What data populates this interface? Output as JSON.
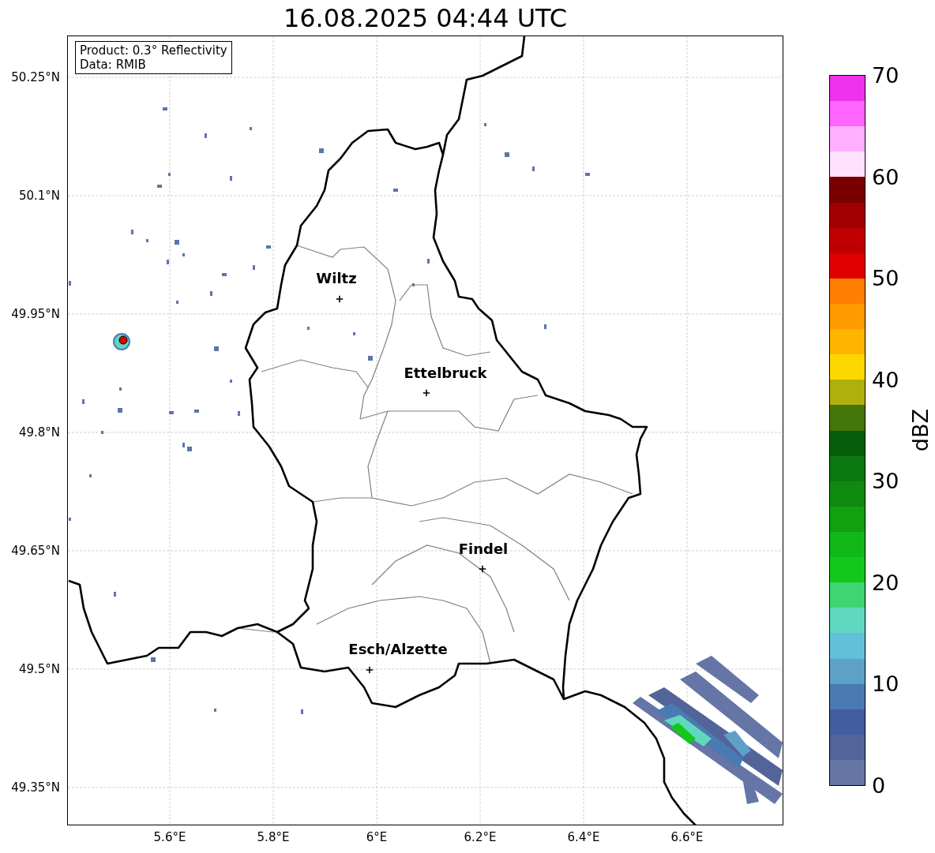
{
  "title": "16.08.2025 04:44 UTC",
  "info_box": [
    "Product: 0.3° Reflectivity",
    "Data: RMIB"
  ],
  "cities": [
    {
      "name": "Wiltz"
    },
    {
      "name": "Ettelbruck"
    },
    {
      "name": "Findel"
    },
    {
      "name": "Esch/Alzette"
    }
  ],
  "lat_ticks": [
    "50.25°N",
    "50.1°N",
    "49.95°N",
    "49.8°N",
    "49.65°N",
    "49.5°N",
    "49.35°N"
  ],
  "lon_ticks": [
    "5.6°E",
    "5.8°E",
    "6°E",
    "6.2°E",
    "6.4°E",
    "6.6°E"
  ],
  "colorbar": {
    "label": "dBZ",
    "ticks": [
      "70",
      "60",
      "50",
      "40",
      "30",
      "20",
      "10",
      "0"
    ],
    "segments": [
      {
        "color": "#ee33ee"
      },
      {
        "color": "#ff66ff"
      },
      {
        "color": "#ffb0ff"
      },
      {
        "color": "#ffe0ff"
      },
      {
        "color": "#7a0000"
      },
      {
        "color": "#a00000"
      },
      {
        "color": "#c00000"
      },
      {
        "color": "#e00000"
      },
      {
        "color": "#ff7f00"
      },
      {
        "color": "#ff9a00"
      },
      {
        "color": "#ffb400"
      },
      {
        "color": "#ffd700"
      },
      {
        "color": "#b0b00a"
      },
      {
        "color": "#45760a"
      },
      {
        "color": "#075e0a"
      },
      {
        "color": "#0a7810"
      },
      {
        "color": "#0e8a0e"
      },
      {
        "color": "#10a010"
      },
      {
        "color": "#12b818"
      },
      {
        "color": "#12c818"
      },
      {
        "color": "#3dd670"
      },
      {
        "color": "#60d8c0"
      },
      {
        "color": "#63c0da"
      },
      {
        "color": "#5da0c8"
      },
      {
        "color": "#4a7ab2"
      },
      {
        "color": "#435ea0"
      },
      {
        "color": "#53649a"
      },
      {
        "color": "#6575a6"
      }
    ]
  }
}
